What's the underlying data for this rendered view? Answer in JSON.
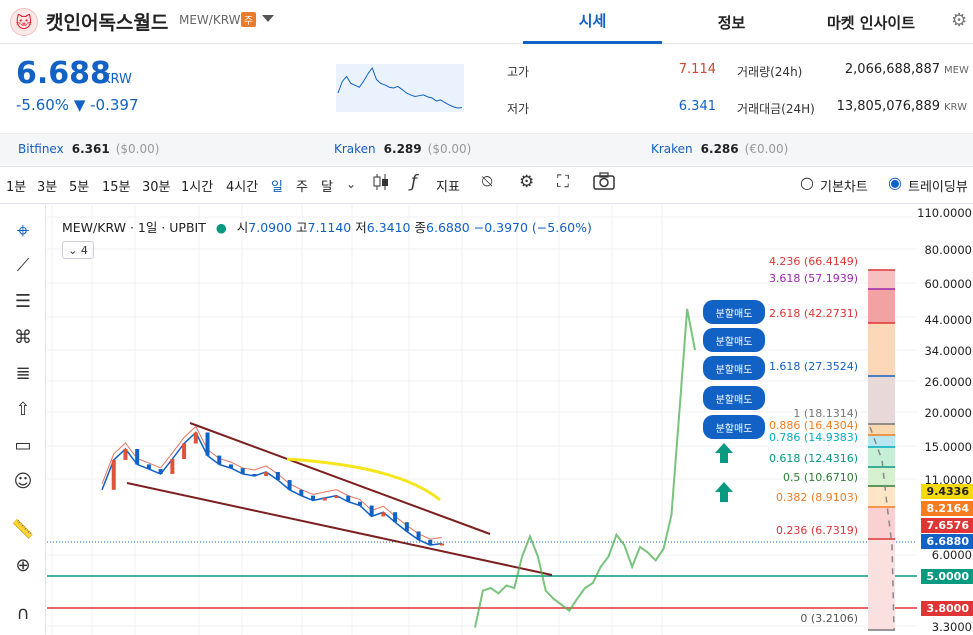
{
  "header": {
    "coin_name": "캣인어독스월드",
    "pair": "MEW/KRW",
    "warning_badge": "주",
    "tabs": [
      "시세",
      "정보",
      "마켓 인사이트"
    ]
  },
  "price": {
    "current": "6.688",
    "unit": "KRW",
    "change": "-5.60% ▼ -0.397"
  },
  "stats": {
    "high_label": "고가",
    "high": "7.114",
    "low_label": "저가",
    "low": "6.341",
    "volume_label": "거래량(24h)",
    "volume": "2,066,688,887",
    "volume_unit": "MEW",
    "value_label": "거래대금(24H)",
    "value": "13,805,076,889",
    "value_unit": "KRW"
  },
  "exchanges": [
    {
      "name": "Bitfinex",
      "price": "6.361",
      "usd": "($0.00)"
    },
    {
      "name": "Kraken",
      "price": "6.289",
      "usd": "($0.00)"
    },
    {
      "name": "Kraken",
      "price": "6.286",
      "usd": "(€0.00)"
    }
  ],
  "toolbar": {
    "intervals": [
      "1분",
      "3분",
      "5분",
      "15분",
      "30분",
      "1시간",
      "4시간",
      "일",
      "주",
      "달"
    ],
    "active_interval": "일",
    "indicators_label": "지표",
    "basic_chart": "기본차트",
    "tradingview": "트레이딩뷰"
  },
  "chart_header": {
    "title": "MEW/KRW · 1일 · UPBIT",
    "open_label": "시",
    "open": "7.0900",
    "high_label": "고",
    "high": "7.1140",
    "low_label": "저",
    "low": "6.3410",
    "close_label": "종",
    "close": "6.6880",
    "change": "−0.3970 (−5.60%)",
    "collapse_count": "4"
  },
  "chart_data": {
    "type": "line",
    "y_scale": "log",
    "y_ticks": [
      "110.0000",
      "80.0000",
      "60.0000",
      "44.0000",
      "34.0000",
      "26.0000",
      "20.0000",
      "15.0000",
      "11.0000",
      "9.0000",
      "6.0000",
      "3.3000"
    ],
    "price_tags": [
      {
        "value": "9.4336",
        "color": "#f5d90a"
      },
      {
        "value": "8.2164",
        "color": "#f57c1f"
      },
      {
        "value": "7.6576",
        "color": "#e03535"
      },
      {
        "value": "6.6880",
        "color": "#1261c4"
      },
      {
        "value": "5.0000",
        "color": "#089981"
      },
      {
        "value": "3.8000",
        "color": "#e03535"
      }
    ],
    "fib_levels": [
      {
        "label": "4.236 (66.4149)",
        "color": "#e03535"
      },
      {
        "label": "3.618 (57.1939)",
        "color": "#9c27b0"
      },
      {
        "label": "2.618 (42.2731)",
        "color": "#e03535"
      },
      {
        "label": "1.618 (27.3524)",
        "color": "#1261c4"
      },
      {
        "label": "1 (18.1314)",
        "color": "#777777"
      },
      {
        "label": "0.886 (16.4304)",
        "color": "#f57c1f"
      },
      {
        "label": "0.786 (14.9383)",
        "color": "#00acc1"
      },
      {
        "label": "0.618 (12.4316)",
        "color": "#089981"
      },
      {
        "label": "0.5 (10.6710)",
        "color": "#2e7d32"
      },
      {
        "label": "0.382 (8.9103)",
        "color": "#f57c1f"
      },
      {
        "label": "0.236 (6.7319)",
        "color": "#e03535"
      },
      {
        "label": "0 (3.2106)",
        "color": "#777777"
      }
    ],
    "mew_close_series": [
      10.5,
      13.5,
      14.8,
      13.0,
      12.5,
      12.0,
      13.6,
      15.5,
      17.0,
      14.0,
      13.0,
      12.6,
      12.0,
      11.8,
      12.2,
      11.4,
      10.5,
      10.0,
      9.6,
      9.8,
      10.0,
      9.5,
      9.2,
      8.4,
      8.7,
      8.0,
      7.4,
      6.9,
      6.6,
      6.688
    ],
    "comparison_series": [
      3.3,
      4.5,
      4.6,
      4.4,
      4.7,
      4.6,
      6.0,
      7.1,
      6.0,
      4.5,
      4.2,
      4.0,
      3.8,
      4.2,
      4.6,
      4.8,
      5.5,
      6.0,
      7.2,
      6.6,
      5.5,
      6.5,
      6.2,
      5.8,
      6.4,
      8.5,
      20.0,
      48.0,
      34.0
    ],
    "split_sell_label": "분할매도"
  }
}
